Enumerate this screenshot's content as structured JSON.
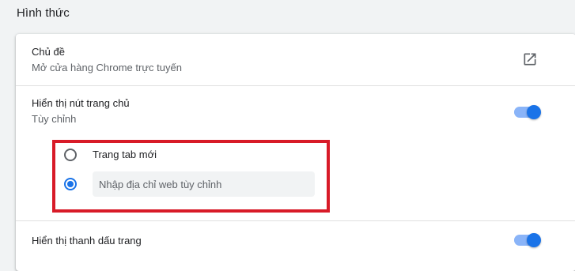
{
  "section": {
    "title": "Hình thức"
  },
  "theme": {
    "title": "Chủ đề",
    "subtitle": "Mở cửa hàng Chrome trực tuyến",
    "icon": "open-in-new-icon"
  },
  "home_button": {
    "title": "Hiển thị nút trang chủ",
    "subtitle": "Tùy chỉnh",
    "enabled": true,
    "options": [
      {
        "label": "Trang tab mới",
        "selected": false
      },
      {
        "placeholder": "Nhập địa chỉ web tùy chỉnh",
        "value": "",
        "selected": true
      }
    ]
  },
  "bookmarks_bar": {
    "title": "Hiển thị thanh dấu trang",
    "enabled": true
  },
  "colors": {
    "accent": "#1a73e8",
    "toggle_track": "#8ab4f8",
    "annotation": "#d81b28"
  }
}
